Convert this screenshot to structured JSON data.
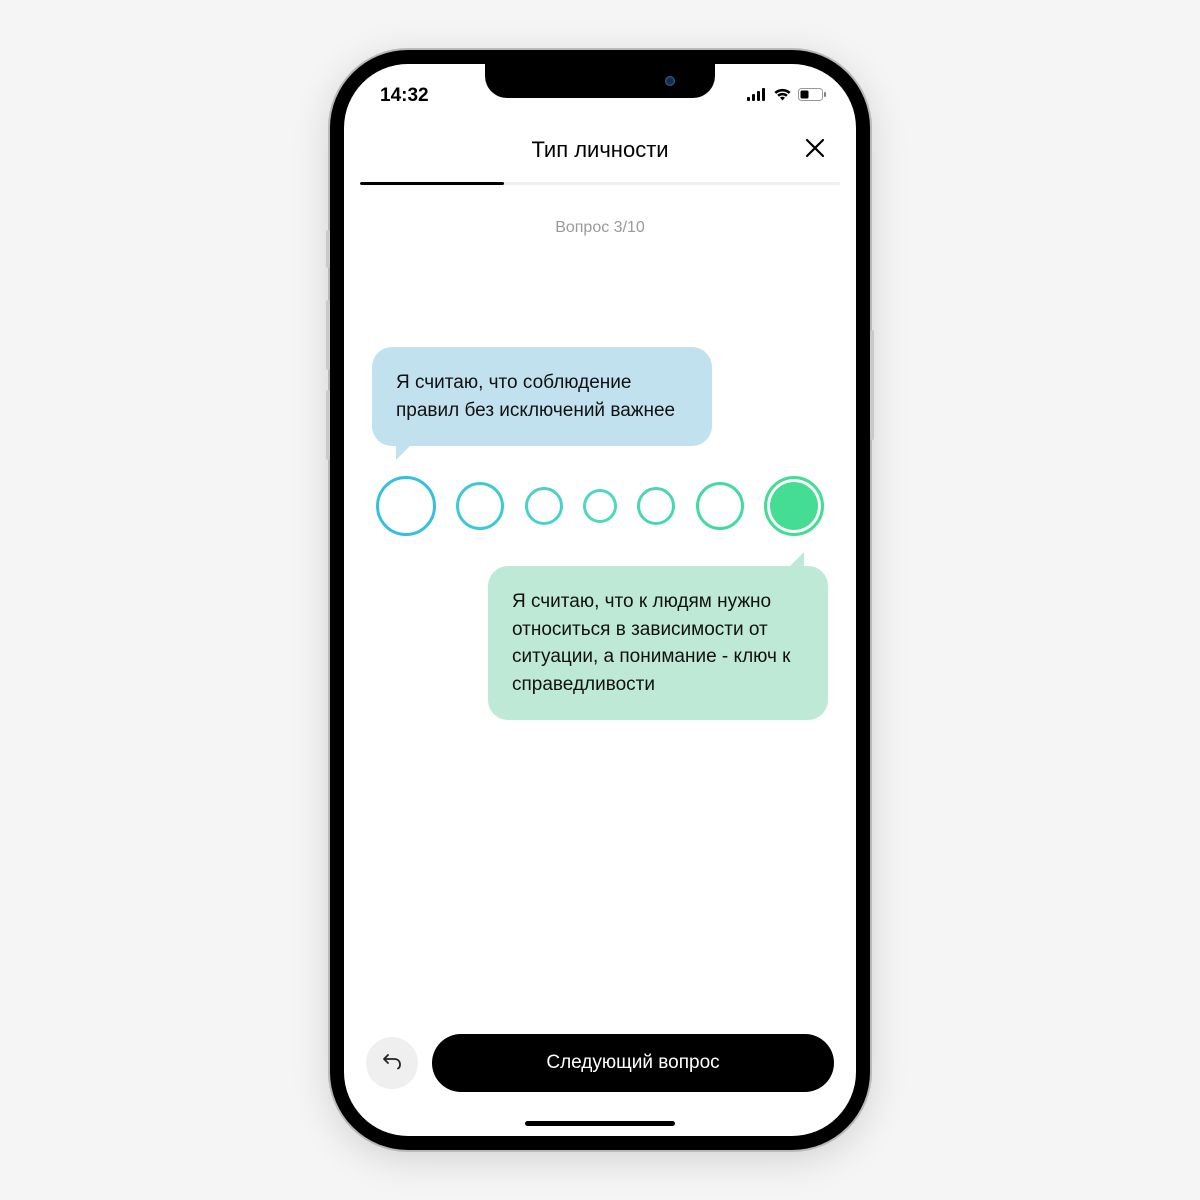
{
  "status": {
    "time": "14:32"
  },
  "nav": {
    "title": "Тип личности"
  },
  "progress": {
    "percent": 30
  },
  "question_counter": "Вопрос 3/10",
  "bubbles": {
    "top": "Я считаю, что соблюдение правил без исключений важнее",
    "bottom": "Я считаю, что к людям нужно относиться в зависимости от ситуации, а понимание - ключ к справедливости"
  },
  "scale": {
    "count": 7,
    "selected_index": 6
  },
  "footer": {
    "next_label": "Следующий вопрос"
  }
}
